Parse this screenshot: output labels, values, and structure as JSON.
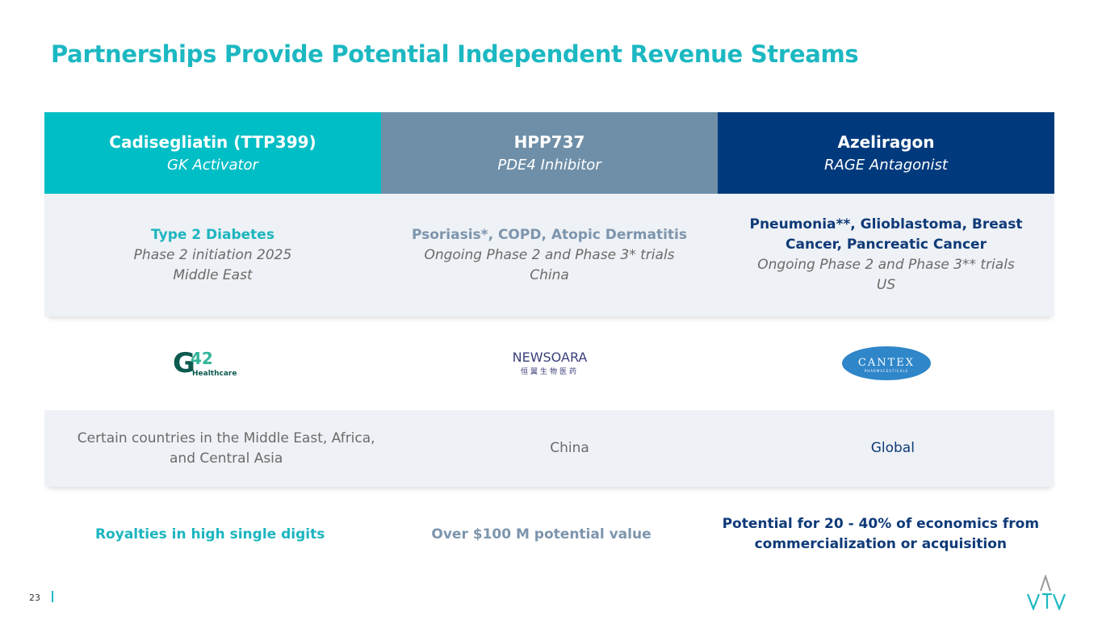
{
  "title": "Partnerships Provide Potential Independent Revenue Streams",
  "colors": {
    "accent": "#1cb8c2",
    "col1": "#00bec5",
    "col2": "#6f8fa8",
    "col3": "#003a7d"
  },
  "columns": [
    {
      "name": "Cadisegliatin (TTP399)",
      "mechanism": "GK Activator",
      "indication": "Type 2 Diabetes",
      "status": "Phase 2 initiation 2025",
      "region": "Middle East",
      "partner_logo": "G42 Healthcare",
      "territory": "Certain countries in the Middle East, Africa, and Central Asia",
      "economics": "Royalties in high single digits"
    },
    {
      "name": "HPP737",
      "mechanism": "PDE4 Inhibitor",
      "indication": "Psoriasis*, COPD, Atopic Dermatitis",
      "status": "Ongoing Phase 2 and Phase 3* trials",
      "region": "China",
      "partner_logo": "NEWSOARA 恒翼生物医药",
      "territory": "China",
      "economics": "Over $100 M potential value"
    },
    {
      "name": "Azeliragon",
      "mechanism": "RAGE Antagonist",
      "indication": "Pneumonia**, Glioblastoma, Breast Cancer, Pancreatic Cancer",
      "status": "Ongoing Phase 2 and Phase 3** trials",
      "region": "US",
      "partner_logo": "CANTEX PHARMACEUTICALS",
      "territory": "Global",
      "economics": "Potential for 20 - 40% of economics from commercialization or acquisition"
    }
  ],
  "page_number": "23",
  "brand_logo": "VTV"
}
